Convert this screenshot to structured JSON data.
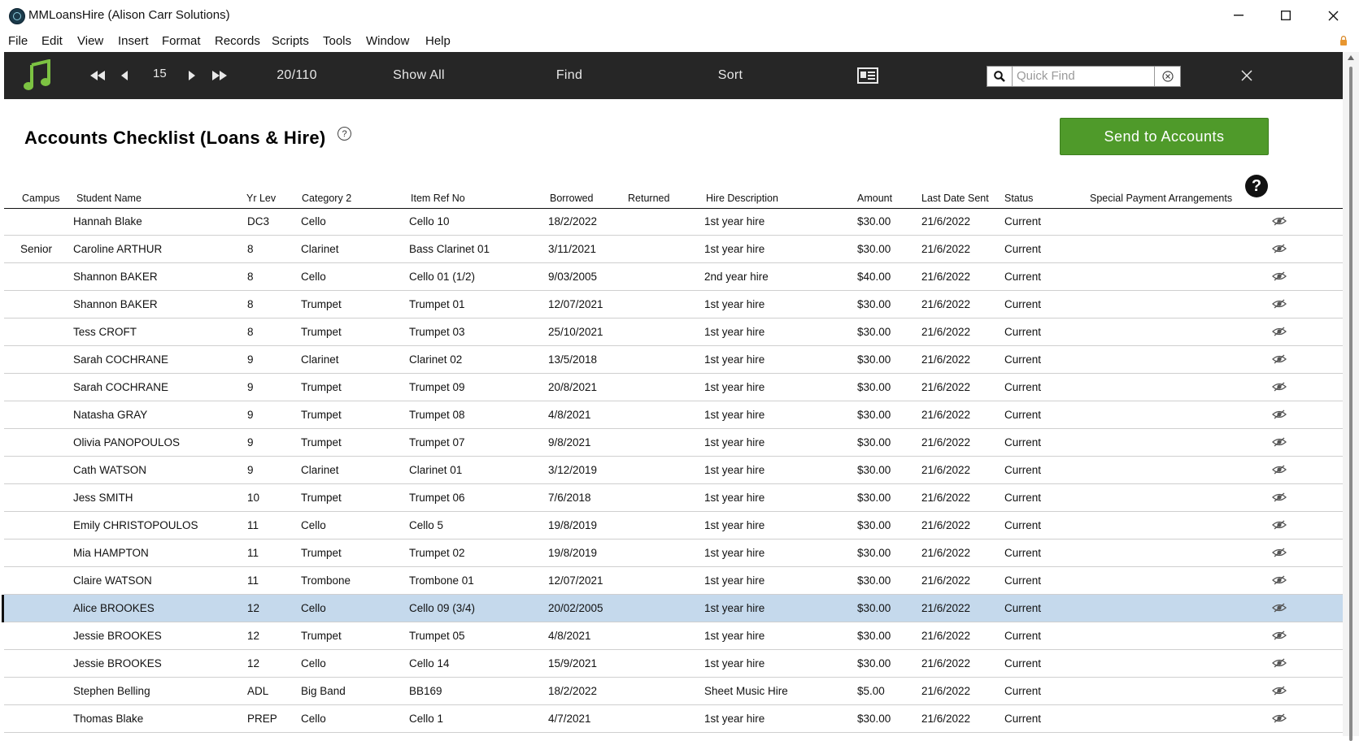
{
  "window": {
    "title": "MMLoansHire (Alison Carr Solutions)",
    "controls": {
      "minimize": "—",
      "maximize": "☐",
      "close": "✕"
    }
  },
  "menu": [
    "File",
    "Edit",
    "View",
    "Insert",
    "Format",
    "Records",
    "Scripts",
    "Tools",
    "Window",
    "Help"
  ],
  "toolbar": {
    "current_record": "15",
    "record_count": "20/110",
    "show_all": "Show All",
    "find": "Find",
    "sort": "Sort",
    "quick_find_placeholder": "Quick Find",
    "icons": [
      "music-note-icon",
      "first-record-icon",
      "previous-record-icon",
      "next-record-icon",
      "last-record-icon",
      "layout-card-icon",
      "search-icon",
      "clear-icon",
      "close-icon"
    ]
  },
  "page": {
    "title": "Accounts Checklist (Loans & Hire)",
    "help_small": "?",
    "send_button": "Send to Accounts",
    "help_big": "?"
  },
  "colors": {
    "toolbar_bg": "#262626",
    "accent_green": "#4f9a2a",
    "music_icon": "#7cc242",
    "selected_row": "#c5d9ec"
  },
  "columns": {
    "campus": "Campus",
    "student": "Student Name",
    "yr": "Yr Lev",
    "category": "Category 2",
    "item": "Item Ref No",
    "borrowed": "Borrowed",
    "returned": "Returned",
    "hire": "Hire Description",
    "amount": "Amount",
    "last_sent": "Last Date Sent",
    "status": "Status",
    "special": "Special Payment Arrangements"
  },
  "rows": [
    {
      "campus": "",
      "student": "Hannah Blake",
      "yr": "DC3",
      "category": "Cello",
      "item": "Cello 10",
      "borrowed": "18/2/2022",
      "returned": "",
      "hire": "1st year hire",
      "amount": "$30.00",
      "last_sent": "21/6/2022",
      "status": "Current"
    },
    {
      "campus": "Senior",
      "student": "Caroline ARTHUR",
      "yr": "8",
      "category": "Clarinet",
      "item": "Bass Clarinet 01",
      "borrowed": "3/11/2021",
      "returned": "",
      "hire": "1st year hire",
      "amount": "$30.00",
      "last_sent": "21/6/2022",
      "status": "Current"
    },
    {
      "campus": "",
      "student": "Shannon BAKER",
      "yr": "8",
      "category": "Cello",
      "item": "Cello 01 (1/2)",
      "borrowed": "9/03/2005",
      "returned": "",
      "hire": "2nd year hire",
      "amount": "$40.00",
      "last_sent": "21/6/2022",
      "status": "Current"
    },
    {
      "campus": "",
      "student": "Shannon BAKER",
      "yr": "8",
      "category": "Trumpet",
      "item": "Trumpet 01",
      "borrowed": "12/07/2021",
      "returned": "",
      "hire": "1st year hire",
      "amount": "$30.00",
      "last_sent": "21/6/2022",
      "status": "Current"
    },
    {
      "campus": "",
      "student": "Tess CROFT",
      "yr": "8",
      "category": "Trumpet",
      "item": "Trumpet 03",
      "borrowed": "25/10/2021",
      "returned": "",
      "hire": "1st year hire",
      "amount": "$30.00",
      "last_sent": "21/6/2022",
      "status": "Current"
    },
    {
      "campus": "",
      "student": "Sarah COCHRANE",
      "yr": "9",
      "category": "Clarinet",
      "item": "Clarinet 02",
      "borrowed": "13/5/2018",
      "returned": "",
      "hire": "1st year hire",
      "amount": "$30.00",
      "last_sent": "21/6/2022",
      "status": "Current"
    },
    {
      "campus": "",
      "student": "Sarah COCHRANE",
      "yr": "9",
      "category": "Trumpet",
      "item": "Trumpet 09",
      "borrowed": "20/8/2021",
      "returned": "",
      "hire": "1st year hire",
      "amount": "$30.00",
      "last_sent": "21/6/2022",
      "status": "Current"
    },
    {
      "campus": "",
      "student": "Natasha GRAY",
      "yr": "9",
      "category": "Trumpet",
      "item": "Trumpet 08",
      "borrowed": "4/8/2021",
      "returned": "",
      "hire": "1st year hire",
      "amount": "$30.00",
      "last_sent": "21/6/2022",
      "status": "Current"
    },
    {
      "campus": "",
      "student": "Olivia PANOPOULOS",
      "yr": "9",
      "category": "Trumpet",
      "item": "Trumpet 07",
      "borrowed": "9/8/2021",
      "returned": "",
      "hire": "1st year hire",
      "amount": "$30.00",
      "last_sent": "21/6/2022",
      "status": "Current"
    },
    {
      "campus": "",
      "student": "Cath WATSON",
      "yr": "9",
      "category": "Clarinet",
      "item": "Clarinet 01",
      "borrowed": "3/12/2019",
      "returned": "",
      "hire": "1st year hire",
      "amount": "$30.00",
      "last_sent": "21/6/2022",
      "status": "Current"
    },
    {
      "campus": "",
      "student": "Jess SMITH",
      "yr": "10",
      "category": "Trumpet",
      "item": "Trumpet 06",
      "borrowed": "7/6/2018",
      "returned": "",
      "hire": "1st year hire",
      "amount": "$30.00",
      "last_sent": "21/6/2022",
      "status": "Current"
    },
    {
      "campus": "",
      "student": "Emily CHRISTOPOULOS",
      "yr": "11",
      "category": "Cello",
      "item": "Cello 5",
      "borrowed": "19/8/2019",
      "returned": "",
      "hire": "1st year hire",
      "amount": "$30.00",
      "last_sent": "21/6/2022",
      "status": "Current"
    },
    {
      "campus": "",
      "student": "Mia HAMPTON",
      "yr": "11",
      "category": "Trumpet",
      "item": "Trumpet 02",
      "borrowed": "19/8/2019",
      "returned": "",
      "hire": "1st year hire",
      "amount": "$30.00",
      "last_sent": "21/6/2022",
      "status": "Current"
    },
    {
      "campus": "",
      "student": "Claire WATSON",
      "yr": "11",
      "category": "Trombone",
      "item": "Trombone 01",
      "borrowed": "12/07/2021",
      "returned": "",
      "hire": "1st year hire",
      "amount": "$30.00",
      "last_sent": "21/6/2022",
      "status": "Current"
    },
    {
      "campus": "",
      "student": "Alice BROOKES",
      "yr": "12",
      "category": "Cello",
      "item": "Cello 09 (3/4)",
      "borrowed": "20/02/2005",
      "returned": "",
      "hire": "1st year hire",
      "amount": "$30.00",
      "last_sent": "21/6/2022",
      "status": "Current",
      "selected": true
    },
    {
      "campus": "",
      "student": "Jessie BROOKES",
      "yr": "12",
      "category": "Trumpet",
      "item": "Trumpet 05",
      "borrowed": "4/8/2021",
      "returned": "",
      "hire": "1st year hire",
      "amount": "$30.00",
      "last_sent": "21/6/2022",
      "status": "Current"
    },
    {
      "campus": "",
      "student": "Jessie BROOKES",
      "yr": "12",
      "category": "Cello",
      "item": "Cello 14",
      "borrowed": "15/9/2021",
      "returned": "",
      "hire": "1st year hire",
      "amount": "$30.00",
      "last_sent": "21/6/2022",
      "status": "Current"
    },
    {
      "campus": "",
      "student": "Stephen Belling",
      "yr": "ADL",
      "category": "Big Band",
      "item": "BB169",
      "borrowed": "18/2/2022",
      "returned": "",
      "hire": "Sheet Music Hire",
      "amount": "$5.00",
      "last_sent": "21/6/2022",
      "status": "Current"
    },
    {
      "campus": "",
      "student": "Thomas Blake",
      "yr": "PREP",
      "category": "Cello",
      "item": "Cello 1",
      "borrowed": "4/7/2021",
      "returned": "",
      "hire": "1st year hire",
      "amount": "$30.00",
      "last_sent": "21/6/2022",
      "status": "Current"
    }
  ]
}
